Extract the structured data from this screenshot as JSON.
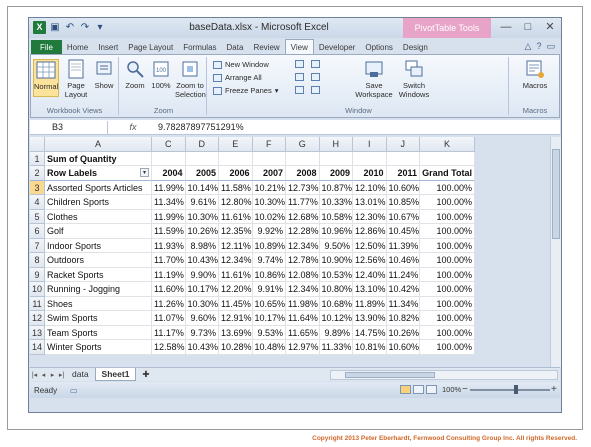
{
  "window": {
    "title": "baseData.xlsx - Microsoft Excel",
    "contextual_tab": "PivotTable Tools",
    "controls": [
      "—",
      "□",
      "✕"
    ]
  },
  "qat": {
    "logo": "X",
    "save_icon": "save-icon",
    "undo_icon": "undo-icon",
    "redo_icon": "redo-icon"
  },
  "tabs": [
    "File",
    "Home",
    "Insert",
    "Page Layout",
    "Formulas",
    "Data",
    "Review",
    "View",
    "Developer",
    "Options",
    "Design"
  ],
  "active_tab": "View",
  "ribbon": {
    "workbook_views": {
      "label": "Workbook Views",
      "normal": "Normal",
      "page_layout": "Page Layout",
      "show": "Show"
    },
    "zoom": {
      "label": "Zoom",
      "zoom": "Zoom",
      "hundred": "100%",
      "to_selection": "Zoom to Selection"
    },
    "window": {
      "label": "Window",
      "new_window": "New Window",
      "arrange_all": "Arrange All",
      "freeze_panes": "Freeze Panes",
      "save_workspace": "Save Workspace",
      "switch_windows": "Switch Windows"
    },
    "macros": {
      "label": "Macros",
      "macros": "Macros"
    }
  },
  "formula_bar": {
    "name_box": "B3",
    "fx": "fx",
    "value": "9.78287897751291%"
  },
  "grid": {
    "col_headers": [
      "A",
      "C",
      "D",
      "E",
      "F",
      "G",
      "H",
      "I",
      "J",
      "K"
    ],
    "rows": [
      {
        "num": "1",
        "cells": [
          "Sum of Quantity",
          "",
          "",
          "",
          "",
          "",
          "",
          "",
          "",
          ""
        ]
      },
      {
        "num": "2",
        "cells": [
          "Row Labels",
          "2004",
          "2005",
          "2006",
          "2007",
          "2008",
          "2009",
          "2010",
          "2011",
          "Grand Total"
        ]
      },
      {
        "num": "3",
        "cells": [
          "Assorted Sports Articles",
          "11.99%",
          "10.14%",
          "11.58%",
          "10.21%",
          "12.73%",
          "10.87%",
          "12.10%",
          "10.60%",
          "100.00%"
        ]
      },
      {
        "num": "4",
        "cells": [
          "Children Sports",
          "11.34%",
          "9.61%",
          "12.80%",
          "10.30%",
          "11.77%",
          "10.33%",
          "13.01%",
          "10.85%",
          "100.00%"
        ]
      },
      {
        "num": "5",
        "cells": [
          "Clothes",
          "11.99%",
          "10.30%",
          "11.61%",
          "10.02%",
          "12.68%",
          "10.58%",
          "12.30%",
          "10.67%",
          "100.00%"
        ]
      },
      {
        "num": "6",
        "cells": [
          "Golf",
          "11.59%",
          "10.26%",
          "12.35%",
          "9.92%",
          "12.28%",
          "10.96%",
          "12.86%",
          "10.45%",
          "100.00%"
        ]
      },
      {
        "num": "7",
        "cells": [
          "Indoor Sports",
          "11.93%",
          "8.98%",
          "12.11%",
          "10.89%",
          "12.34%",
          "9.50%",
          "12.50%",
          "11.39%",
          "100.00%"
        ]
      },
      {
        "num": "8",
        "cells": [
          "Outdoors",
          "11.70%",
          "10.43%",
          "12.34%",
          "9.74%",
          "12.78%",
          "10.90%",
          "12.56%",
          "10.46%",
          "100.00%"
        ]
      },
      {
        "num": "9",
        "cells": [
          "Racket Sports",
          "11.19%",
          "9.90%",
          "11.61%",
          "10.86%",
          "12.08%",
          "10.53%",
          "12.40%",
          "11.24%",
          "100.00%"
        ]
      },
      {
        "num": "10",
        "cells": [
          "Running - Jogging",
          "11.60%",
          "10.17%",
          "12.20%",
          "9.91%",
          "12.34%",
          "10.80%",
          "13.10%",
          "10.42%",
          "100.00%"
        ]
      },
      {
        "num": "11",
        "cells": [
          "Shoes",
          "11.26%",
          "10.30%",
          "11.45%",
          "10.65%",
          "11.98%",
          "10.68%",
          "11.89%",
          "11.34%",
          "100.00%"
        ]
      },
      {
        "num": "12",
        "cells": [
          "Swim Sports",
          "11.07%",
          "9.60%",
          "12.91%",
          "10.17%",
          "11.64%",
          "10.12%",
          "13.90%",
          "10.82%",
          "100.00%"
        ]
      },
      {
        "num": "13",
        "cells": [
          "Team Sports",
          "11.17%",
          "9.73%",
          "13.69%",
          "9.53%",
          "11.65%",
          "9.89%",
          "14.75%",
          "10.26%",
          "100.00%"
        ]
      },
      {
        "num": "14",
        "cells": [
          "Winter Sports",
          "12.58%",
          "10.43%",
          "10.28%",
          "10.48%",
          "12.97%",
          "11.33%",
          "10.81%",
          "10.60%",
          "100.00%"
        ]
      }
    ]
  },
  "sheets": [
    "data",
    "Sheet1"
  ],
  "active_sheet": "Sheet1",
  "status": {
    "ready": "Ready",
    "zoom": "100%",
    "zoom_level": 1.0
  },
  "copyright": "Copyright 2013 Peter Eberhardt, Fernwood Consulting Group Inc. All rights Reserved.",
  "colors": {
    "file_tab": "#1f7a3c",
    "contextual": "#e8a3c8",
    "selection": "#f8d98f",
    "copyright": "#d0682a"
  }
}
